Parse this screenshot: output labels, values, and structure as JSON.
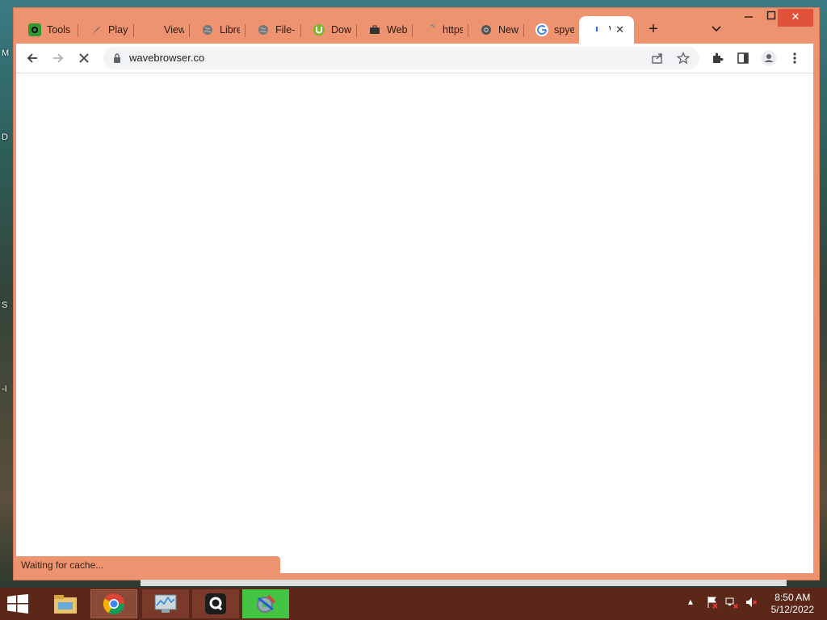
{
  "desktop": {
    "labels": [
      "M",
      "D",
      "S",
      "-I"
    ]
  },
  "browser": {
    "tabs": [
      {
        "title": "Tools",
        "icon": "tools-icon",
        "color": "#2e9a2e"
      },
      {
        "title": "Play T",
        "icon": "rocket-icon",
        "color": "#666666"
      },
      {
        "title": "View",
        "icon": "",
        "color": ""
      },
      {
        "title": "Libre",
        "icon": "globe-icon",
        "color": "#777777"
      },
      {
        "title": "File-S",
        "icon": "globe-icon",
        "color": "#777777"
      },
      {
        "title": "Down",
        "icon": "utorrent-icon",
        "color": "#76b82a"
      },
      {
        "title": "Web",
        "icon": "briefcase-icon",
        "color": "#333333"
      },
      {
        "title": "https",
        "icon": "loading-icon",
        "color": "#888888"
      },
      {
        "title": "New",
        "icon": "chrome-icon",
        "color": "#555555"
      },
      {
        "title": "spyey",
        "icon": "google-icon",
        "color": "#4285f4"
      },
      {
        "title": "W",
        "icon": "loading-icon",
        "color": "#1a73e8",
        "active": true
      }
    ],
    "address": {
      "url": "wavebrowser.co"
    },
    "status_text": "Waiting for cache...",
    "accent_color": "#ee9370"
  },
  "taskbar": {
    "apps": [
      "file-explorer-icon",
      "chrome-icon",
      "resource-monitor-icon",
      "q-app-icon",
      "settings-tool-icon"
    ],
    "clock": {
      "time": "8:50 AM",
      "date": "5/12/2022"
    }
  }
}
